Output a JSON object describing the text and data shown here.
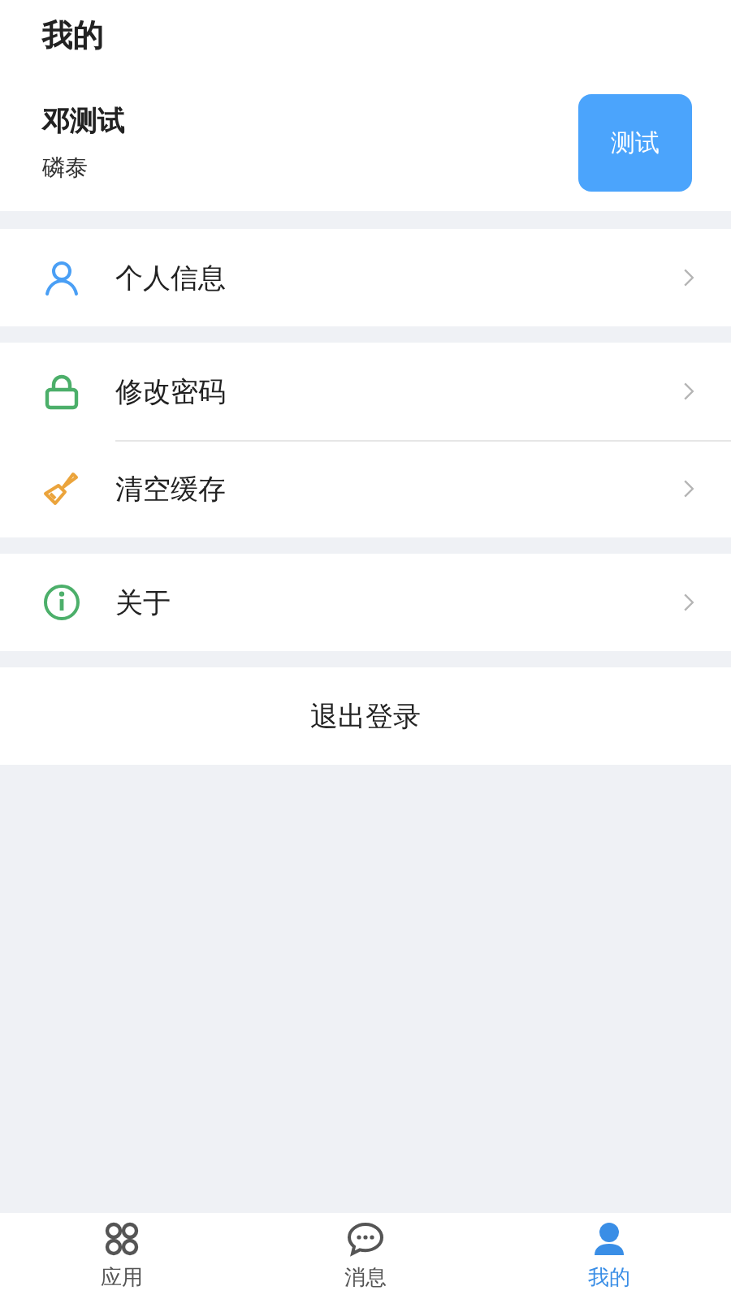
{
  "header": {
    "title": "我的"
  },
  "profile": {
    "name": "邓测试",
    "company": "磷泰",
    "button": "测试"
  },
  "groups": [
    {
      "items": [
        {
          "kind": "person",
          "label": "个人信息"
        }
      ]
    },
    {
      "items": [
        {
          "kind": "lock",
          "label": "修改密码"
        },
        {
          "kind": "brush",
          "label": "清空缓存"
        }
      ]
    },
    {
      "items": [
        {
          "kind": "info",
          "label": "关于"
        }
      ]
    }
  ],
  "logout": "退出登录",
  "tabs": [
    {
      "kind": "apps",
      "label": "应用",
      "selected": false
    },
    {
      "kind": "chat",
      "label": "消息",
      "selected": false
    },
    {
      "kind": "user",
      "label": "我的",
      "selected": true
    }
  ]
}
